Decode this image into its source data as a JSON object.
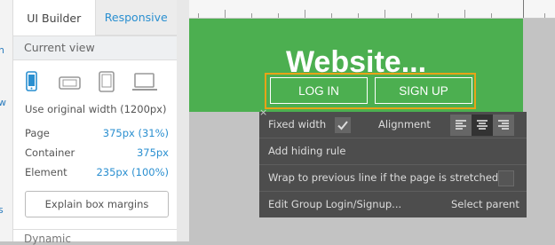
{
  "left_strip": {
    "fragments": [
      "n",
      "w",
      "s"
    ]
  },
  "tabs": [
    {
      "label": "UI Builder",
      "active": true
    },
    {
      "label": "Responsive",
      "active": false
    }
  ],
  "current_view": {
    "header": "Current view",
    "devices": [
      "phone-icon",
      "landscape-phone-icon",
      "tablet-icon",
      "laptop-icon"
    ],
    "checkbox_label": "Use original width (1200px)"
  },
  "dims": [
    {
      "key": "Page",
      "value": "375px (31%)"
    },
    {
      "key": "Container",
      "value": "375px"
    },
    {
      "key": "Element",
      "value": "235px (100%)"
    }
  ],
  "explain_button": "Explain box margins",
  "bottom_section": "Dynamic",
  "site": {
    "title": "Website...",
    "login": "LOG IN",
    "signup": "SIGN UP",
    "bg_color": "#4caf50",
    "group_border": "#e8a317"
  },
  "popover": {
    "fixed_width": "Fixed width",
    "alignment": "Alignment",
    "add_hiding_rule": "Add hiding rule",
    "wrap_label": "Wrap to previous line if the page is stretched",
    "edit_group": "Edit Group Login/Signup...",
    "select_parent": "Select parent",
    "close": "×"
  }
}
